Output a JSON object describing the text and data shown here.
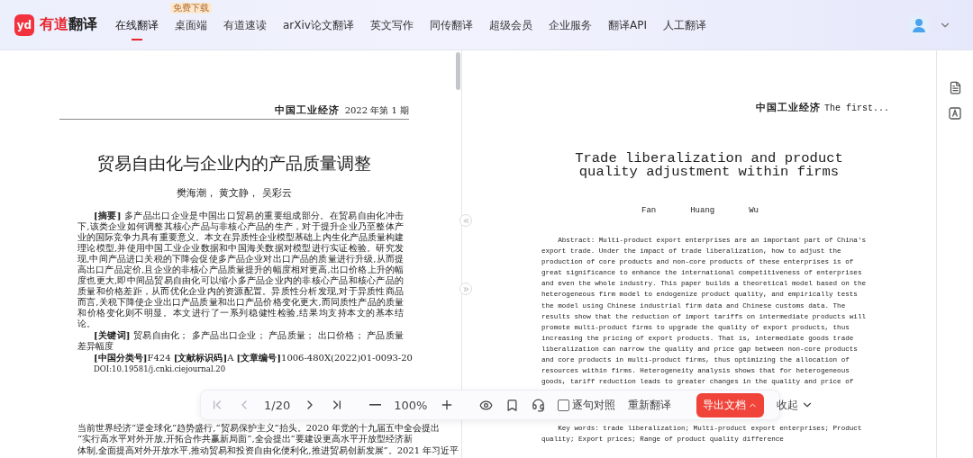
{
  "logo": {
    "mark": "yd",
    "brand": "有道",
    "product": "翻译"
  },
  "nav": [
    {
      "label": "在线翻译",
      "selected": true
    },
    {
      "label": "桌面端",
      "selected": false,
      "badge": "免费下载"
    },
    {
      "label": "有道速读",
      "selected": false
    },
    {
      "label": "arXiv论文翻译",
      "selected": false
    },
    {
      "label": "英文写作",
      "selected": false
    },
    {
      "label": "同传翻译",
      "selected": false
    },
    {
      "label": "超级会员",
      "selected": false
    },
    {
      "label": "企业服务",
      "selected": false
    },
    {
      "label": "翻译API",
      "selected": false
    },
    {
      "label": "人工翻译",
      "selected": false
    }
  ],
  "left_doc": {
    "journal": "中国工业经济",
    "issue": "2022 年第 1 期",
    "title": "贸易自由化与企业内的产品质量调整",
    "authors": "樊海潮， 黄文静， 吴彩云",
    "abstract": "**[摘要]**  多产品出口企业是中国出口贸易的重要组成部分。在贸易自由化冲击下,该类企业如何调整其核心产品与非核心产品的生产，对于提升企业乃至整体产业的国际竞争力具有重要意义。本文在异质性企业模型基础上内生化产品质量构建理论模型,并使用中国工业企业数据和中国海关数据对模型进行实证检验。研究发现,中间产品进口关税的下降会促使多产品企业对出口产品的质量进行升级,从而提高出口产品定价,且企业的非核心产品质量提升的幅度相对更高,出口价格上升的幅度也更大,即中间品贸易自由化可以缩小多产品企业内的非核心产品和核心产品的质量和价格差距，从而优化企业内的资源配置。异质性分析发现,对于异质性商品而言,关税下降使企业出口产品质量和出口产品价格变化更大,而同质性产品的质量和价格变化则不明显。本文进行了一系列稳健性检验,结果均支持本文的基本结论。",
    "keywords": "**[关键词]**  贸易自由化； 多产品出口企业； 产品质量； 出口价格； 产品质量差异幅度",
    "classification": "**[中国分类号]**F424  **[文献标识码]**A  **[文章编号]**1006-480X(2022)01-0093-20",
    "doi": "DOI:10.19581/j.cnki.ciejournal.20",
    "body": [
      "当前世界经济“逆全球化”趋势盛行,“贸易保护主义”抬头。2020 年党的十九届五中全会提出",
      "“实行高水平对外开放,开拓合作共赢新局面”,全会提出“要建设更高水平开放型经济新",
      "体制,全面提高对外开放水平,推动贸易和投资自由化便利化,推进贸易创新发展”。2021 年习近平"
    ]
  },
  "right_doc": {
    "journal": "中国工业经济",
    "issue": "The first...",
    "title": [
      "Trade liberalization and product",
      "quality adjustment within firms"
    ],
    "authors": [
      "Fan",
      "Huang",
      "Wu"
    ],
    "abstract": [
      "    Abstract: Multi-product export enterprises are an important part of China's",
      "export trade. Under the impact of trade liberalization, how to adjust the",
      "production of core products and non-core products of these enterprises is of",
      "great significance to enhance the international competitiveness of enterprises",
      "and even the whole industry. This paper builds a theoretical model based on the",
      "heterogeneous firm model to endogenize product quality, and empirically tests",
      "the model using Chinese industrial firm data and Chinese customs data. The",
      "results show that the reduction of import tariffs on intermediate products will",
      "promote multi-product firms to upgrade the quality of export products, thus",
      "increasing the pricing of export products. That is, intermediate goods trade",
      "liberalization can narrow the quality and price gap between non-core products",
      "and core products in multi-product firms, thus optimizing the allocation of",
      "resources within firms. Heterogeneity analysis shows that for heterogeneous",
      "goods, tariff reduction leads to greater changes in the quality and price of"
    ],
    "keywords": [
      "    Key words: trade liberalization; Multi-product export enterprises; Product",
      "quality; Export prices; Range of product quality difference"
    ]
  },
  "toolbar": {
    "nav_buttons": [
      {
        "kind": "first",
        "disabled": true
      },
      {
        "kind": "prev",
        "disabled": true
      },
      {
        "kind": "page",
        "label": "1/20",
        "disabled": false
      },
      {
        "kind": "next",
        "disabled": false
      },
      {
        "kind": "last",
        "disabled": false
      }
    ],
    "zoom": "100%",
    "compare": {
      "label": "逐句对照",
      "checked": false
    },
    "retranslate": "重新翻译",
    "export": "导出文档",
    "collapse": "收起"
  }
}
